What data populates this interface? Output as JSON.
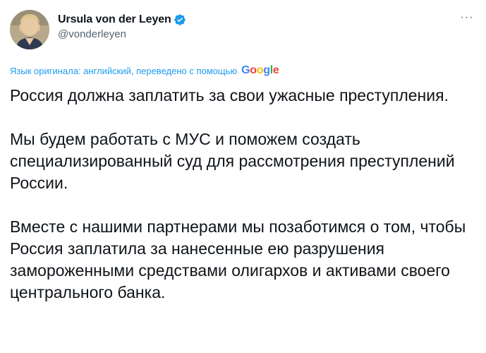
{
  "author": {
    "display_name": "Ursula von der Leyen",
    "handle": "@vonderleyen",
    "verified_icon": "verified-badge-icon",
    "avatar_icon": "avatar-photo"
  },
  "menu": {
    "more_icon": "more-horizontal-icon",
    "more_label": "···"
  },
  "translation": {
    "label": "Язык оригинала: английский, переведено с помощью",
    "provider": "Google",
    "link_color": "#1d9bf0"
  },
  "tweet": {
    "paragraphs": [
      "Россия должна заплатить за свои ужасные преступления.",
      "Мы будем работать с МУС и поможем создать специализированный суд для рассмотрения преступлений России.",
      "Вместе с нашими партнерами мы позаботимся о том, чтобы Россия заплатила за нанесенные ею разрушения замороженными средствами олигархов и активами своего центрального банка."
    ]
  },
  "colors": {
    "text": "#0f1419",
    "secondary": "#536471",
    "verified": "#1d9bf0"
  }
}
